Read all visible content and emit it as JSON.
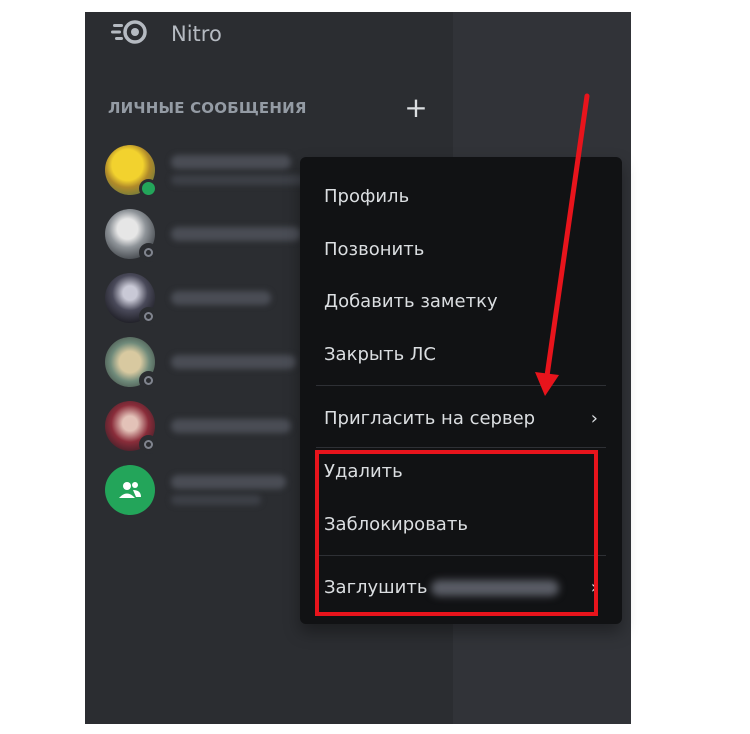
{
  "app": {
    "name": "Nitro"
  },
  "sidebar": {
    "section_title": "ЛИЧНЫЕ СООБЩЕНИЯ",
    "add_label": "+",
    "dm_items": [
      {
        "status": "online",
        "avatar_color": "#c8b24a"
      },
      {
        "status": "offline",
        "avatar_color": "#9aa0a6"
      },
      {
        "status": "offline",
        "avatar_color": "#3a3a46"
      },
      {
        "status": "offline",
        "avatar_color": "#8e8a72"
      },
      {
        "status": "offline",
        "avatar_color": "#7a3a4a"
      },
      {
        "status": "none",
        "avatar_color": "#23a55a",
        "icon": "group-icon"
      }
    ]
  },
  "context_menu": {
    "profile": "Профиль",
    "call": "Позвонить",
    "add_note": "Добавить заметку",
    "close_dm": "Закрыть ЛС",
    "invite": "Пригласить на сервер",
    "remove": "Удалить",
    "block": "Заблокировать",
    "mute": "Заглушить",
    "submenu_indicator": "›"
  },
  "annotation": {
    "highlight_color": "#e8141c",
    "arrow_color": "#e8141c"
  },
  "colors": {
    "sidebar_bg": "#2b2d31",
    "chat_bg": "#313338",
    "menu_bg": "#111214",
    "text": "#dbdee1",
    "muted": "#949ba4",
    "online": "#23a55a"
  }
}
